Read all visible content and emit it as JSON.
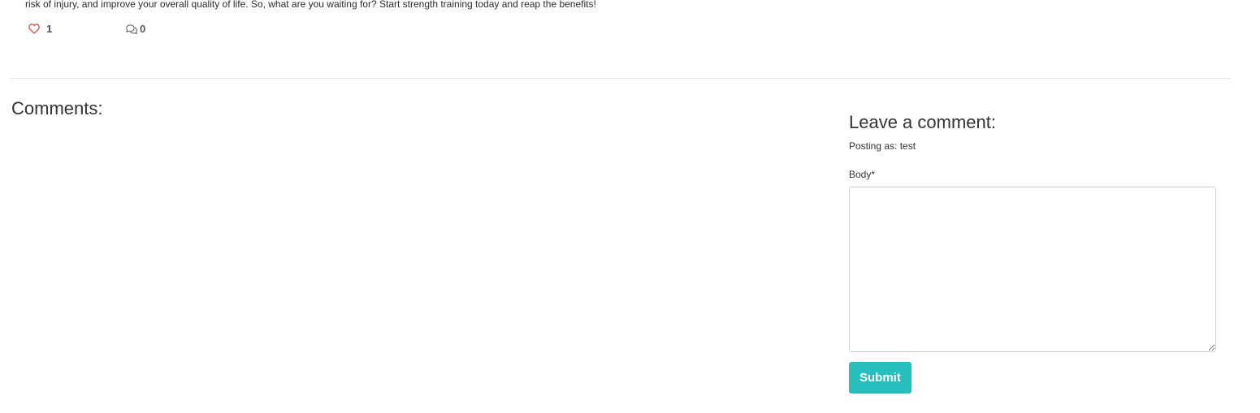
{
  "post": {
    "body_tail": "risk of injury, and improve your overall quality of life. So, what are you waiting for? Start strength training today and reap the benefits!",
    "likes": "1",
    "comments": "0"
  },
  "comments_section": {
    "heading": "Comments:"
  },
  "comment_form": {
    "heading": "Leave a comment:",
    "posting_as": "Posting as: test",
    "body_label": "Body*",
    "body_value": "",
    "submit_label": "Submit"
  },
  "colors": {
    "accent": "#26bfbd",
    "like_heart": "#d9534f"
  },
  "icons": {
    "like": "heart-outline-icon",
    "comment": "comment-bubbles-icon"
  }
}
